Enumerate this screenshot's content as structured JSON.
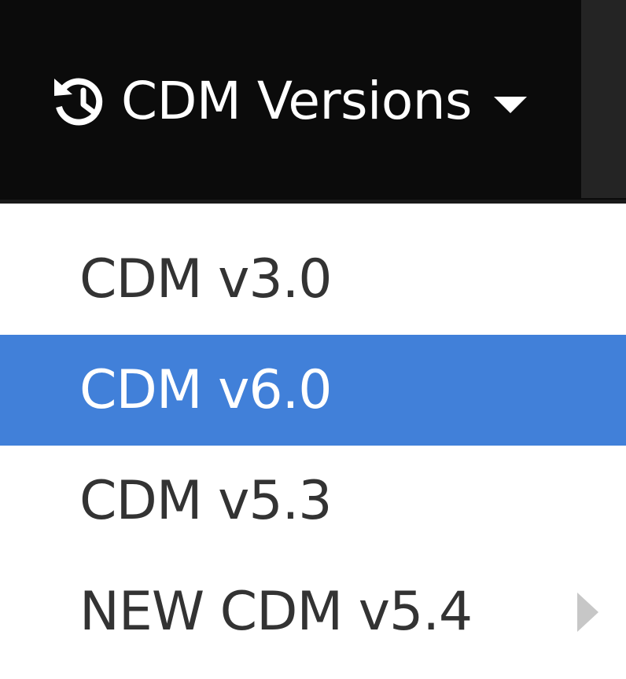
{
  "navbar": {
    "versions_toggle": {
      "label": "CDM Versions",
      "icon": "history-icon",
      "caret_icon": "caret-down-icon"
    }
  },
  "dropdown": {
    "items": [
      {
        "label": "CDM v3.0",
        "active": false,
        "has_submenu": false
      },
      {
        "label": "CDM v6.0",
        "active": true,
        "has_submenu": false
      },
      {
        "label": "CDM v5.3",
        "active": false,
        "has_submenu": false
      },
      {
        "label": "NEW CDM v5.4",
        "active": false,
        "has_submenu": true,
        "submenu_icon": "chevron-right-icon"
      }
    ]
  },
  "colors": {
    "navbar_bg": "#0b0b0b",
    "active_item_bg": "#4180d9",
    "item_text": "#333333",
    "submenu_arrow": "#c7c7c7"
  }
}
